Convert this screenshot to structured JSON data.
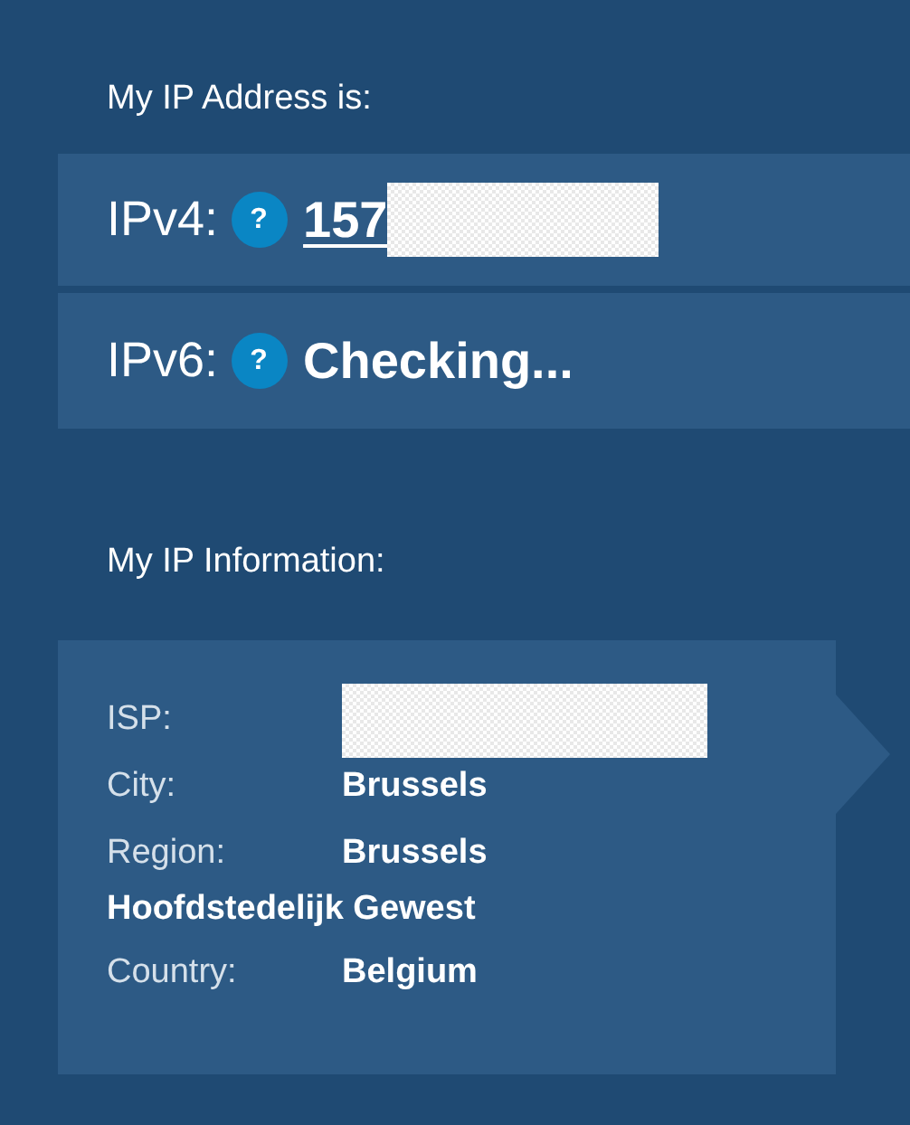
{
  "address_heading": "My IP Address is:",
  "addresses": [
    {
      "label": "IPv4:",
      "help": "?",
      "value": "157",
      "link": true,
      "redacted": true
    },
    {
      "label": "IPv6:",
      "help": "?",
      "value": "Checking...",
      "link": false,
      "redacted": false
    }
  ],
  "info_heading": "My IP Information:",
  "info": [
    {
      "label": "ISP:",
      "kind": "redacted"
    },
    {
      "label": "City:",
      "kind": "text",
      "value": "Brussels"
    },
    {
      "label": "Region:",
      "kind": "text",
      "value": "Brussels",
      "value_continued": "Hoofdstedelijk Gewest"
    },
    {
      "label": "Country:",
      "kind": "text",
      "value": "Belgium"
    }
  ]
}
